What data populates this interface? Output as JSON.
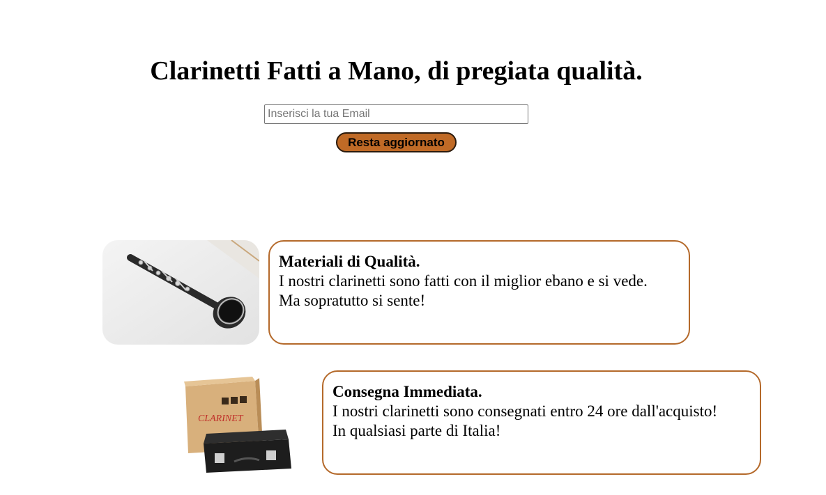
{
  "header": {
    "title": "Clarinetti Fatti a Mano, di pregiata qualità."
  },
  "signup": {
    "email_placeholder": "Inserisci la tua Email",
    "email_value": "",
    "button_label": "Resta aggiornato"
  },
  "features": [
    {
      "title": "Materiali di Qualità.",
      "lines": [
        "I nostri clarinetti sono fatti con il miglior ebano e si vede.",
        "Ma sopratutto si sente!"
      ],
      "image_icon": "clarinet-photo"
    },
    {
      "title": "Consegna Immediata.",
      "lines": [
        "I nostri clarinetti sono consegnati entro 24 ore dall'acquisto!",
        "In qualsiasi parte di Italia!"
      ],
      "image_icon": "clarinet-box-and-case-photo",
      "image_box_label": "CLARINET"
    }
  ],
  "colors": {
    "accent_border": "#b4692a",
    "button_fill": "#c06a26"
  }
}
